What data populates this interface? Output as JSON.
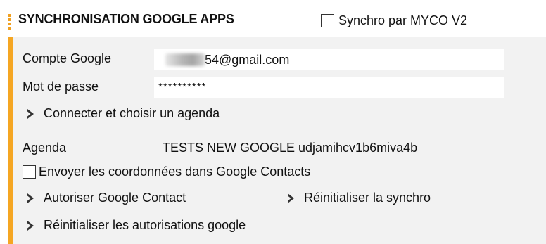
{
  "header": {
    "title": "SYNCHRONISATION GOOGLE APPS",
    "myco_checkbox_label": "Synchro par MYCO V2"
  },
  "form": {
    "account_label": "Compte Google",
    "account_value": "54@gmail.com",
    "password_label": "Mot de passe",
    "password_value": "**********",
    "connect_link": "Connecter et choisir un agenda",
    "agenda_label": "Agenda",
    "agenda_value": "TESTS NEW GOOGLE udjamihcv1b6miva4b",
    "contacts_checkbox_label": "Envoyer les coordonnées dans Google Contacts",
    "authorize_contact_link": "Autoriser Google Contact",
    "reset_sync_link": "Réinitialiser la synchro",
    "reset_auth_link": "Réinitialiser les autorisations google"
  },
  "colors": {
    "accent": "#f5a623",
    "panel_bg": "#f2f2f2"
  },
  "icons": [
    "chevron-right-icon",
    "checkbox-icon"
  ]
}
